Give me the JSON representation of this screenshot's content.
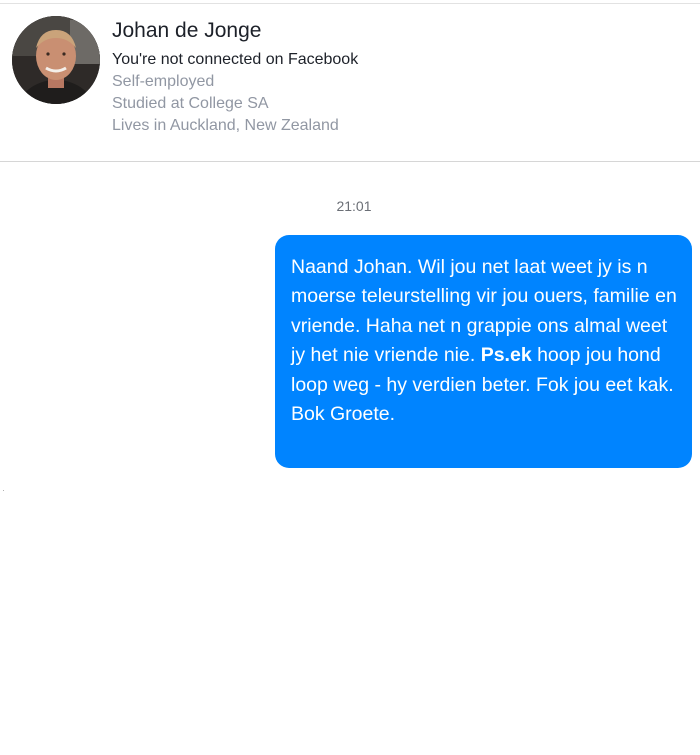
{
  "profile": {
    "name": "Johan de Jonge",
    "connection_status": "You're not connected on Facebook",
    "details": [
      "Self-employed",
      "Studied at College SA",
      "Lives in Auckland, New Zealand"
    ]
  },
  "conversation": {
    "timestamp": "21:01",
    "messages": [
      {
        "direction": "outgoing",
        "text_before_bold": "Naand Johan. Wil jou net laat weet jy is n moerse teleurstelling vir jou ouers, familie en vriende. Haha net n grappie ons almal weet jy het nie vriende nie. ",
        "bold_text": "Ps.ek",
        "text_after_bold": " hoop jou hond loop weg - hy verdien beter. Fok jou eet kak. Bok Groete."
      }
    ]
  },
  "colors": {
    "bubble_background": "#0084ff",
    "bubble_text": "#ffffff",
    "primary_text": "#1d2129",
    "secondary_text": "#9197a3",
    "divider": "#d6d6d6"
  },
  "icons": {
    "avatar": "profile-photo"
  }
}
